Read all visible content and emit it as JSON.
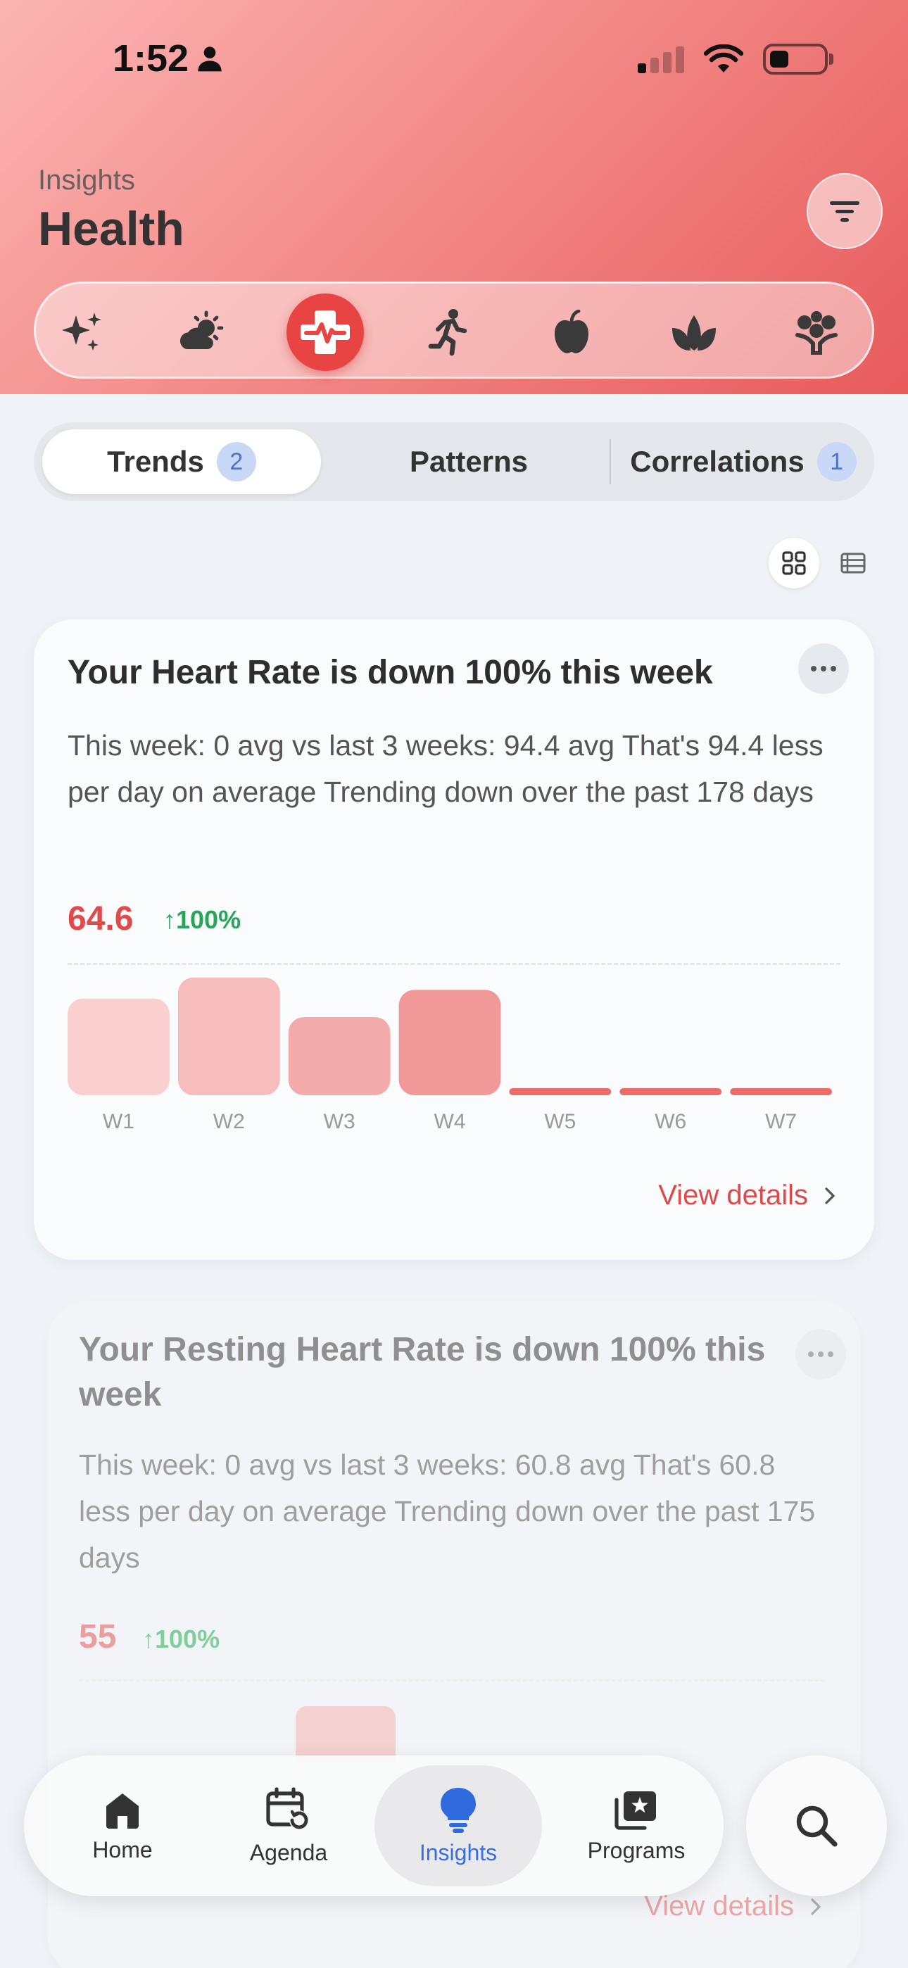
{
  "status_bar": {
    "time": "1:52"
  },
  "header": {
    "subtitle": "Insights",
    "title": "Health"
  },
  "categories": [
    {
      "icon": "sparkles-icon",
      "active": false
    },
    {
      "icon": "weather-icon",
      "active": false
    },
    {
      "icon": "health-icon",
      "active": true
    },
    {
      "icon": "running-icon",
      "active": false
    },
    {
      "icon": "apple-icon",
      "active": false
    },
    {
      "icon": "leaf-icon",
      "active": false
    },
    {
      "icon": "tree-icon",
      "active": false
    }
  ],
  "tabs": {
    "trends": {
      "label": "Trends",
      "badge": "2"
    },
    "patterns": {
      "label": "Patterns"
    },
    "correlations": {
      "label": "Correlations",
      "badge": "1"
    }
  },
  "cards": [
    {
      "title": "Your Heart Rate is down 100% this week",
      "description": "This week: 0 avg vs last 3 weeks: 94.4 avg That's 94.4 less per day on average Trending down over the past 178 days",
      "value": "64.6",
      "change": "↑100%",
      "view_details": "View details"
    },
    {
      "title": "Your Resting Heart Rate is down 100% this week",
      "description": "This week: 0 avg vs last 3 weeks: 60.8 avg That's 60.8 less per day on average Trending down over the past 175 days",
      "value": "55",
      "change": "↑100%",
      "view_details": "View details"
    }
  ],
  "chart_data": {
    "type": "bar",
    "categories": [
      "W1",
      "W2",
      "W3",
      "W4",
      "W5",
      "W6",
      "W7"
    ],
    "values": [
      78,
      95,
      63,
      85,
      0,
      0,
      0
    ],
    "ylim": [
      0,
      100
    ],
    "grid": false
  },
  "nav": {
    "home": "Home",
    "agenda": "Agenda",
    "insights": "Insights",
    "programs": "Programs"
  },
  "colors": {
    "accent": "#e84444",
    "bar_light": "#f9cfcf",
    "bar_dark": "#f29a9a",
    "positive": "#2aa45a",
    "nav_active": "#3a6ee0"
  }
}
